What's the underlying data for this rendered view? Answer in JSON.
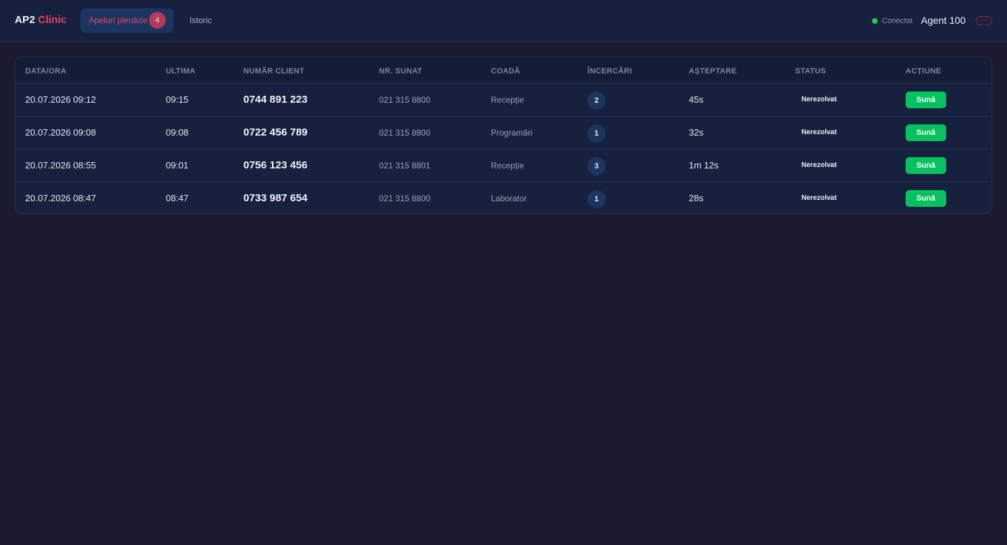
{
  "brand": {
    "name": "AP2",
    "accent": "Clinic"
  },
  "nav": {
    "tabs": [
      {
        "label": "Apeluri pierdute",
        "badge": "4",
        "active": true
      },
      {
        "label": "Istoric",
        "active": false
      }
    ]
  },
  "status": {
    "label": "Conectat",
    "color": "#1fce5a"
  },
  "agent": {
    "name": "Agent 100"
  },
  "table": {
    "columns": [
      "DATA/ORA",
      "ULTIMA",
      "NUMĂR CLIENT",
      "NR. SUNAT",
      "COADĂ",
      "ÎNCERCĂRI",
      "AȘTEPTARE",
      "STATUS",
      "ACȚIUNE"
    ],
    "rows": [
      {
        "date": "20.07.2026 09:12",
        "last": "09:15",
        "client": "0744 891 223",
        "dialed": "021 315 8800",
        "queue": "Recepție",
        "tries": "2",
        "wait": "45s",
        "status": "Nerezolvat",
        "action": "Sună"
      },
      {
        "date": "20.07.2026 09:08",
        "last": "09:08",
        "client": "0722 456 789",
        "dialed": "021 315 8800",
        "queue": "Programări",
        "tries": "1",
        "wait": "32s",
        "status": "Nerezolvat",
        "action": "Sună"
      },
      {
        "date": "20.07.2026 08:55",
        "last": "09:01",
        "client": "0756 123 456",
        "dialed": "021 315 8801",
        "queue": "Recepție",
        "tries": "3",
        "wait": "1m 12s",
        "status": "Nerezolvat",
        "action": "Sună"
      },
      {
        "date": "20.07.2026 08:47",
        "last": "08:47",
        "client": "0733 987 654",
        "dialed": "021 315 8800",
        "queue": "Laborator",
        "tries": "1",
        "wait": "28s",
        "status": "Nerezolvat",
        "action": "Sună"
      }
    ]
  },
  "colors": {
    "accent": "#e8455e",
    "action": "#07c160",
    "background": "#1a1b2e"
  }
}
